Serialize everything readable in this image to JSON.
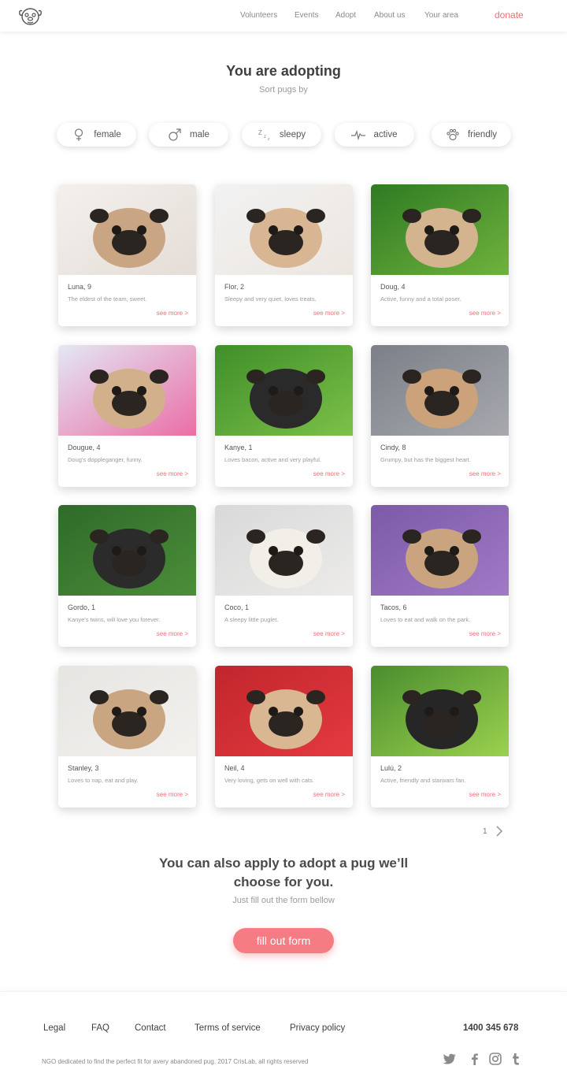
{
  "header": {
    "nav": [
      {
        "label": "Volunteers"
      },
      {
        "label": "Events"
      },
      {
        "label": "Adopt"
      },
      {
        "label": "About us"
      },
      {
        "label": "Your area"
      }
    ],
    "donate_label": "donate",
    "logo_icon": "pug-face-icon"
  },
  "intro": {
    "title": "You are adopting",
    "subtitle": "Sort pugs by"
  },
  "filters": [
    {
      "label": "female",
      "icon": "female-symbol-icon"
    },
    {
      "label": "male",
      "icon": "male-symbol-icon"
    },
    {
      "label": "sleepy",
      "icon": "sleep-zzz-icon"
    },
    {
      "label": "active",
      "icon": "heartbeat-icon"
    },
    {
      "label": "friendly",
      "icon": "paw-icon"
    }
  ],
  "pugs": [
    {
      "name": "Luna, 9",
      "desc": "The eldest of the team, sweet.",
      "more": "see more >"
    },
    {
      "name": "Flor, 2",
      "desc": "Sleepy and very quiet, loves treats.",
      "more": "see more >"
    },
    {
      "name": "Doug, 4",
      "desc": "Active, funny and a total poser.",
      "more": "see more >"
    },
    {
      "name": "Dougue, 4",
      "desc": "Doug's doppleganger, funny.",
      "more": "see more >"
    },
    {
      "name": "Kanye, 1",
      "desc": "Loves bacon, active and very playful.",
      "more": "see more >"
    },
    {
      "name": "Cindy, 8",
      "desc": "Grumpy, but has the biggest heart.",
      "more": "see more >"
    },
    {
      "name": "Gordo, 1",
      "desc": "Kanye's twins, will love you forever.",
      "more": "see more >"
    },
    {
      "name": "Coco, 1",
      "desc": "A sleepy little puglet.",
      "more": "see more >"
    },
    {
      "name": "Tacos, 6",
      "desc": "Loves to eat and walk on the park.",
      "more": "see more >"
    },
    {
      "name": "Stanley, 3",
      "desc": "Loves to nap, eat and play.",
      "more": "see more >"
    },
    {
      "name": "Neil, 4",
      "desc": "Very loving, gets on well with cats.",
      "more": "see more >"
    },
    {
      "name": "Lulú, 2",
      "desc": "Active, friendly and starwars fan.",
      "more": "see more >"
    }
  ],
  "pagination": {
    "page": "1"
  },
  "apply": {
    "title": "You can also apply to adopt a pug we’ll choose for you.",
    "subtitle": "Just fill out the form bellow",
    "button_label": "fill out form"
  },
  "footer": {
    "links": [
      {
        "label": "Legal"
      },
      {
        "label": "FAQ"
      },
      {
        "label": "Contact"
      },
      {
        "label": "Terms of service"
      },
      {
        "label": "Privacy policy"
      }
    ],
    "phone": "1400 345 678",
    "copyright": "NGO dedicated to find the perfect fit for avery abandoned pug. 2017 CrisLab, all rights reserved",
    "social": [
      "twitter-icon",
      "facebook-icon",
      "instagram-icon",
      "tumblr-icon"
    ]
  },
  "colors": {
    "accent": "#f06e78",
    "button": "#f47c82"
  }
}
